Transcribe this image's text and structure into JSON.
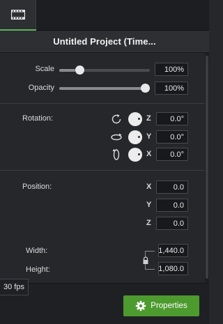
{
  "tabs": [
    {
      "icon": "film-icon",
      "active": true
    }
  ],
  "title": "Untitled Project (Time...",
  "scale": {
    "label": "Scale",
    "value": "100%",
    "slider_fraction": 0.18
  },
  "opacity": {
    "label": "Opacity",
    "value": "100%",
    "slider_fraction": 1.0
  },
  "rotation": {
    "label": "Rotation:",
    "axes": [
      {
        "axis": "Z",
        "value": "0.0°",
        "icon": "rotate-z-icon"
      },
      {
        "axis": "Y",
        "value": "0.0°",
        "icon": "rotate-y-icon"
      },
      {
        "axis": "X",
        "value": "0.0°",
        "icon": "rotate-x-icon"
      }
    ]
  },
  "position": {
    "label": "Position:",
    "axes": [
      {
        "axis": "X",
        "value": "0.0"
      },
      {
        "axis": "Y",
        "value": "0.0"
      },
      {
        "axis": "Z",
        "value": "0.0"
      }
    ]
  },
  "size": {
    "width_label": "Width:",
    "width_value": "1,440.0",
    "height_label": "Height:",
    "height_value": "1,080.0",
    "lock_icon": "lock-icon"
  },
  "footer": {
    "fps": "30 fps",
    "properties_label": "Properties",
    "properties_icon": "gear-icon"
  },
  "colors": {
    "accent": "#4d9a2f",
    "tab_indicator": "#5ab55a",
    "background": "#26272b"
  }
}
